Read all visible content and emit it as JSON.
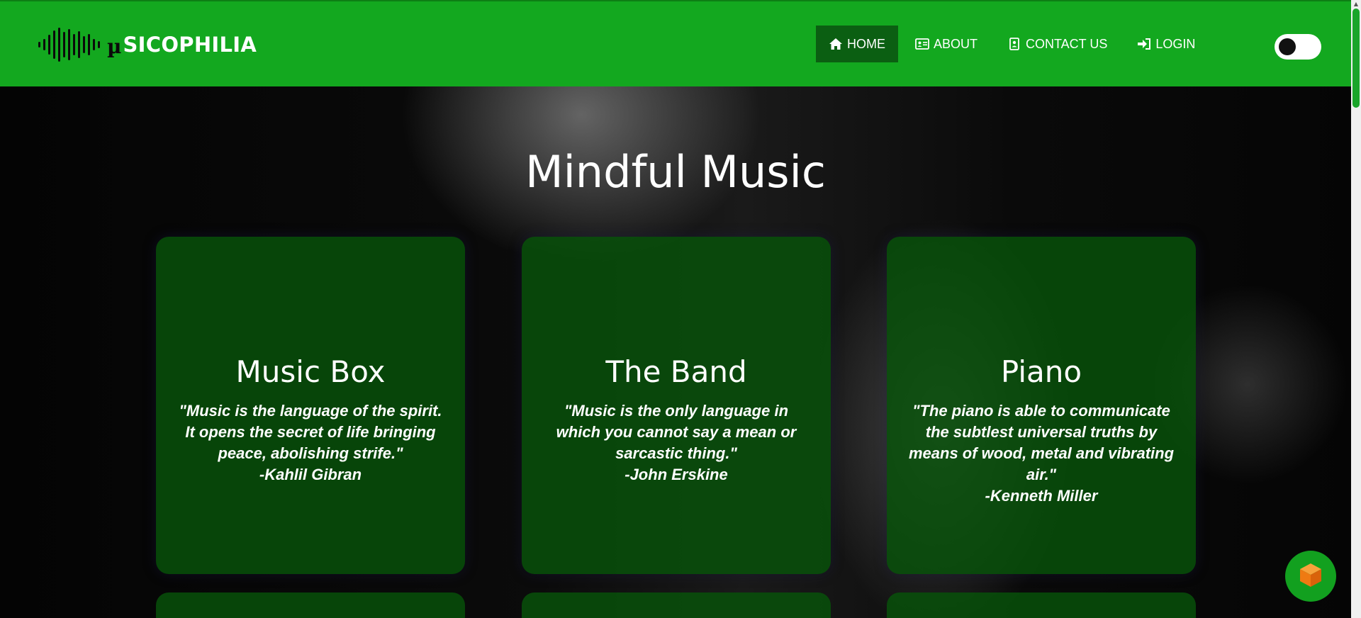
{
  "brand": {
    "mu": "µ",
    "name": "SICOPHILIA"
  },
  "nav": {
    "items": [
      {
        "label": "HOME",
        "icon": "home-icon",
        "active": true
      },
      {
        "label": "ABOUT",
        "icon": "id-card-icon",
        "active": false
      },
      {
        "label": "CONTACT US",
        "icon": "contact-book-icon",
        "active": false
      },
      {
        "label": "LOGIN",
        "icon": "login-icon",
        "active": false
      }
    ],
    "theme_toggle": {
      "state": "off"
    }
  },
  "hero": {
    "title": "Mindful Music"
  },
  "cards": [
    {
      "title": "Music Box",
      "quote": "\"Music is the language of the spirit. It opens the secret of life bringing peace, abolishing strife.\"",
      "author": "-Kahlil Gibran"
    },
    {
      "title": "The Band",
      "quote": "\"Music is the only language in which you cannot say a mean or sarcastic thing.\"",
      "author": "-John Erskine"
    },
    {
      "title": "Piano",
      "quote": "\"The piano is able to communicate the subtlest universal truths by means of wood, metal and vibrating air.\"",
      "author": "-Kenneth Miller"
    }
  ],
  "colors": {
    "brand_green": "#13a81f",
    "active_nav": "#0b5f12",
    "card_green": "#07530a",
    "scroll_thumb": "#1aa52a"
  },
  "fab": {
    "icon": "cube-icon"
  }
}
